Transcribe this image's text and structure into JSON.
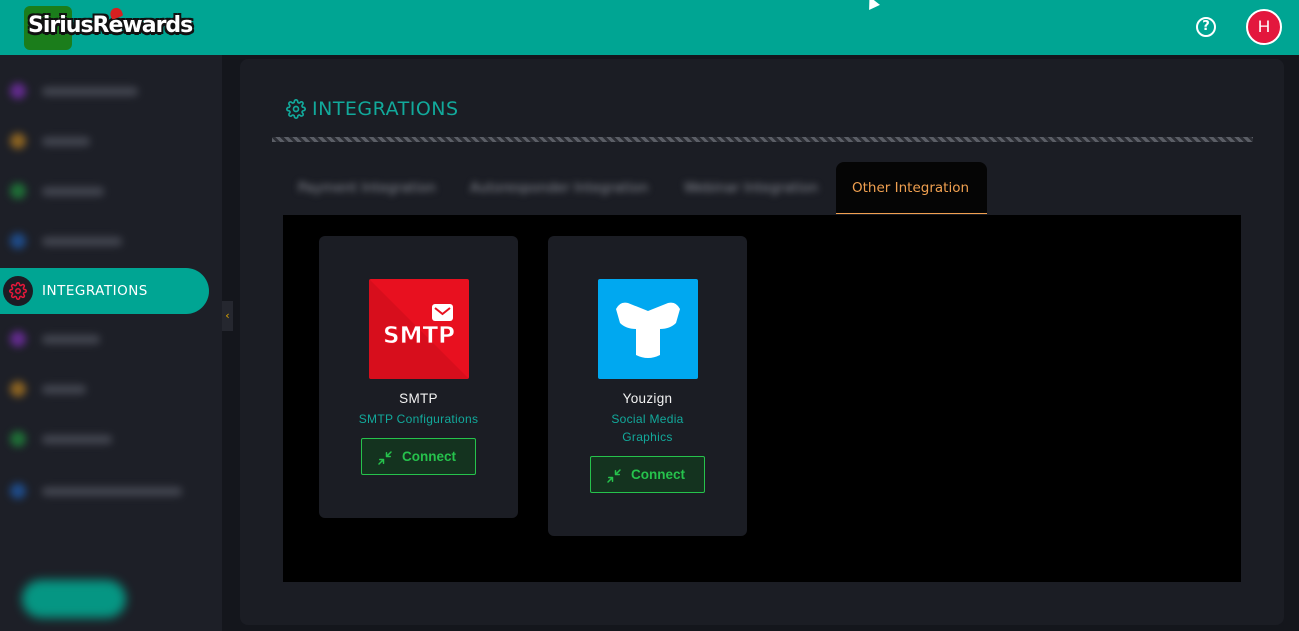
{
  "brand": {
    "name_part1": "Sirius",
    "name_part2": "Rewards"
  },
  "header": {
    "avatar_initial": "H",
    "help_icon": "question-circle-icon"
  },
  "sidebar": {
    "active_item": {
      "label": "INTEGRATIONS",
      "icon": "gear-icon"
    },
    "collapse_icon": "chevron-left-icon"
  },
  "page": {
    "title": "INTEGRATIONS",
    "title_icon": "gear-icon"
  },
  "tabs": [
    {
      "label": "Payment Integration",
      "active": false
    },
    {
      "label": "Autoresponder Integration",
      "active": false
    },
    {
      "label": "Webinar Integration",
      "active": false
    },
    {
      "label": "Other Integration",
      "active": true
    }
  ],
  "integrations": [
    {
      "name": "SMTP",
      "description": "SMTP Configurations",
      "button_label": "Connect",
      "logo_text": "SMTP",
      "color": "#e8101f"
    },
    {
      "name": "Youzign",
      "description": "Social Media Graphics",
      "button_label": "Connect",
      "color": "#00a8f0"
    }
  ],
  "colors": {
    "accent": "#00a593",
    "connect": "#26c24c",
    "active_tab": "#f0a050",
    "avatar": "#e3173d"
  }
}
